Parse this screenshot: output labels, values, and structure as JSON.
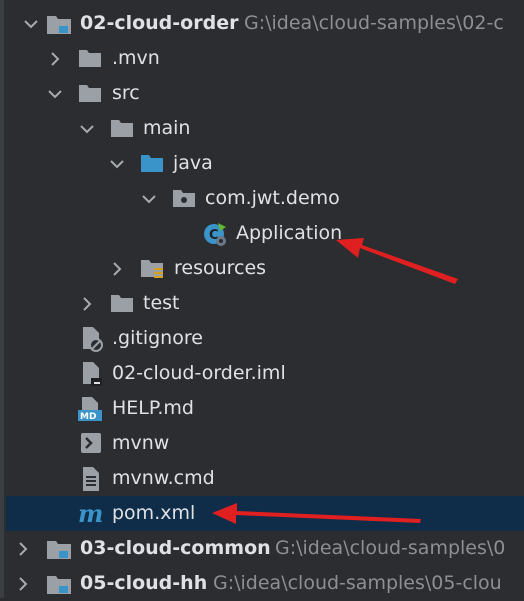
{
  "tree": {
    "root": {
      "name": "02-cloud-order",
      "path": "G:\\idea\\cloud-samples\\02-c"
    },
    "mvn": ".mvn",
    "src": "src",
    "main": "main",
    "java": "java",
    "package": "com.jwt.demo",
    "application": "Application",
    "resources": "resources",
    "test": "test",
    "gitignore": ".gitignore",
    "iml": "02-cloud-order.iml",
    "help": "HELP.md",
    "mvnw": "mvnw",
    "mvnw_cmd": "mvnw.cmd",
    "pom": "pom.xml",
    "module_common": {
      "name": "03-cloud-common",
      "path": "G:\\idea\\cloud-samples\\0"
    },
    "module_hh": {
      "name": "05-cloud-hh",
      "path": "G:\\idea\\cloud-samples\\05-clou"
    }
  },
  "colors": {
    "background": "#2b2d30",
    "selection": "#0f2c48",
    "folder": "#9aa0a6",
    "source_folder": "#3a93c9",
    "annotation_arrow": "#e02020"
  }
}
